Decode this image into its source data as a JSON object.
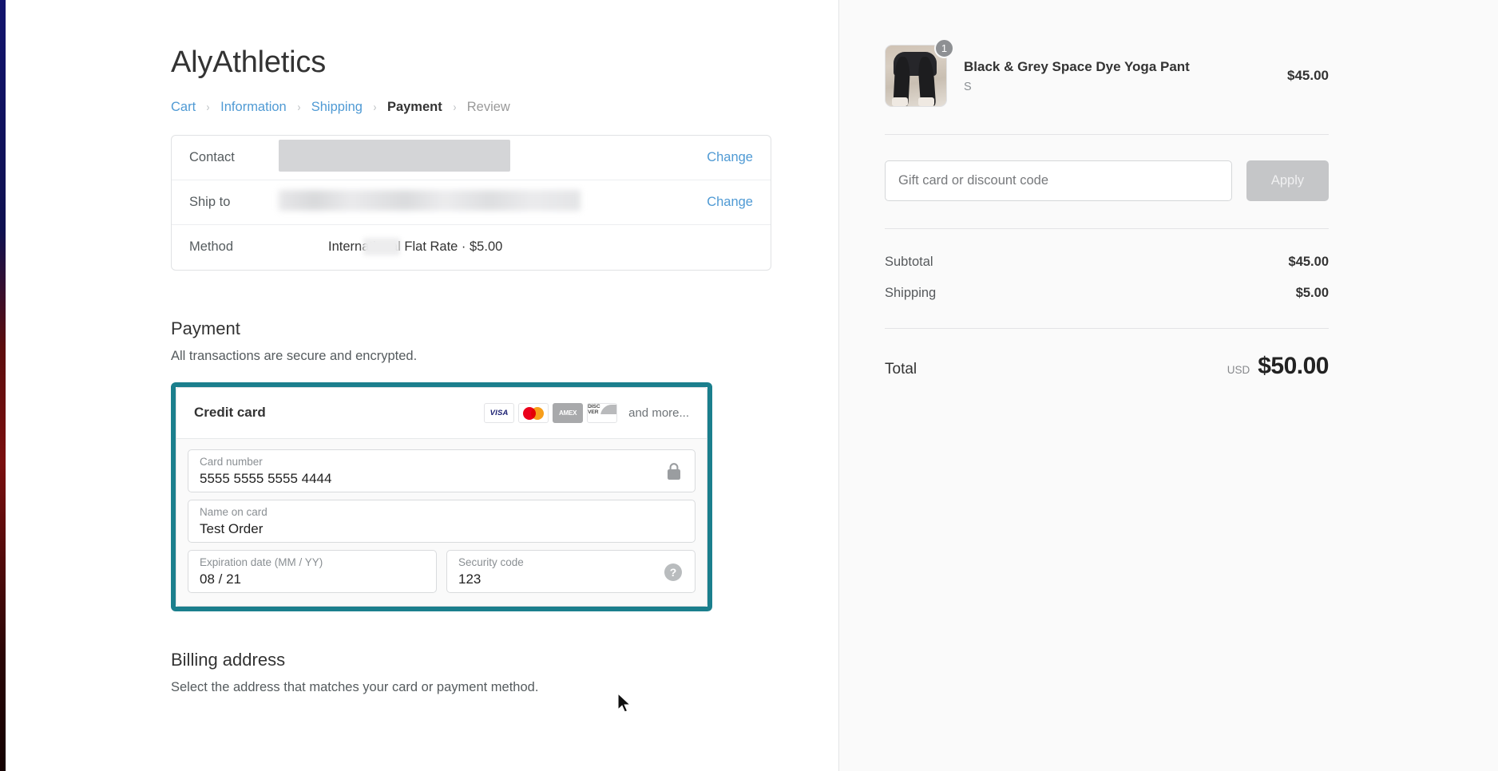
{
  "shop": {
    "name": "AlyAthletics"
  },
  "breadcrumb": {
    "items": [
      {
        "label": "Cart",
        "state": "link"
      },
      {
        "label": "Information",
        "state": "link"
      },
      {
        "label": "Shipping",
        "state": "link"
      },
      {
        "label": "Payment",
        "state": "current"
      },
      {
        "label": "Review",
        "state": "upcoming"
      }
    ],
    "separator": "›"
  },
  "summary": {
    "rows": [
      {
        "label": "Contact",
        "value": "",
        "redacted": true,
        "action": "Change"
      },
      {
        "label": "Ship to",
        "value": "",
        "redacted": true,
        "action": "Change"
      },
      {
        "label": "Method",
        "value": "International Flat Rate · $5.00",
        "redacted": false,
        "action": ""
      }
    ]
  },
  "payment": {
    "title": "Payment",
    "subtitle": "All transactions are secure and encrypted.",
    "highlight_color": "#1b7f8d",
    "method": {
      "title": "Credit card",
      "brands": [
        {
          "name": "visa-logo",
          "label": "VISA"
        },
        {
          "name": "mastercard-logo",
          "label": ""
        },
        {
          "name": "amex-logo",
          "label": "AMEX"
        },
        {
          "name": "discover-logo",
          "label": "DISC VER"
        }
      ],
      "more_label": "and more..."
    },
    "fields": {
      "card_number": {
        "label": "Card number",
        "value": "5555 5555 5555 4444",
        "placeholder": "Card number"
      },
      "name_on_card": {
        "label": "Name on card",
        "value": "Test Order",
        "placeholder": "Name on card"
      },
      "expiration": {
        "label": "Expiration date (MM / YY)",
        "value": "08 / 21",
        "placeholder": "Expiration date (MM / YY)"
      },
      "security_code": {
        "label": "Security code",
        "value": "123",
        "placeholder": "Security code"
      }
    },
    "help_glyph": "?"
  },
  "billing": {
    "title": "Billing address",
    "subtitle": "Select the address that matches your card or payment method."
  },
  "order_summary": {
    "product": {
      "title": "Black & Grey Space Dye Yoga Pant",
      "variant": "S",
      "price": "$45.00",
      "quantity": "1"
    },
    "discount": {
      "placeholder": "Gift card or discount code",
      "value": "",
      "apply_label": "Apply"
    },
    "lines": [
      {
        "label": "Subtotal",
        "value": "$45.00"
      },
      {
        "label": "Shipping",
        "value": "$5.00"
      }
    ],
    "total": {
      "label": "Total",
      "currency": "USD",
      "value": "$50.00"
    }
  }
}
